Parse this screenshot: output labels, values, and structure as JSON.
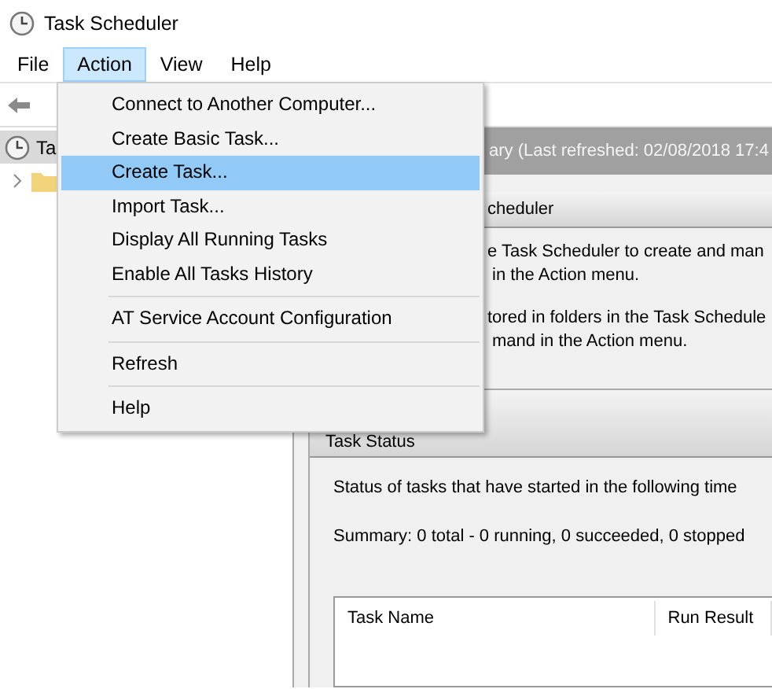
{
  "window": {
    "title": "Task Scheduler"
  },
  "menu_bar": [
    {
      "label": "File",
      "selected": false
    },
    {
      "label": "Action",
      "selected": true
    },
    {
      "label": "View",
      "selected": false
    },
    {
      "label": "Help",
      "selected": false
    }
  ],
  "action_menu": [
    {
      "kind": "item",
      "label": "Connect to Another Computer...",
      "selected": false
    },
    {
      "kind": "item",
      "label": "Create Basic Task...",
      "selected": false
    },
    {
      "kind": "item",
      "label": "Create Task...",
      "selected": true
    },
    {
      "kind": "item",
      "label": "Import Task...",
      "selected": false
    },
    {
      "kind": "item",
      "label": "Display All Running Tasks",
      "selected": false
    },
    {
      "kind": "item",
      "label": "Enable All Tasks History",
      "selected": false
    },
    {
      "kind": "separator"
    },
    {
      "kind": "item",
      "label": "AT Service Account Configuration",
      "selected": false
    },
    {
      "kind": "separator"
    },
    {
      "kind": "item",
      "label": "Refresh",
      "selected": false
    },
    {
      "kind": "separator"
    },
    {
      "kind": "item",
      "label": "Help",
      "selected": false
    }
  ],
  "tree": [
    {
      "label": "Ta",
      "selected": true
    }
  ],
  "summary_header": "ary (Last refreshed: 02/08/2018 17:4",
  "overview": {
    "title": "cheduler",
    "paragraphs": [
      [
        "e Task Scheduler to create and man",
        "in the Action menu."
      ],
      [
        "tored in folders in the Task Schedule",
        "mand in the Action menu."
      ]
    ]
  },
  "task_status": {
    "title": "Task Status",
    "lines": [
      "Status of tasks that have started in the following time",
      "Summary: 0 total - 0 running, 0 succeeded, 0 stopped"
    ],
    "table": {
      "columns": [
        "Task Name",
        "Run Result"
      ]
    }
  }
}
